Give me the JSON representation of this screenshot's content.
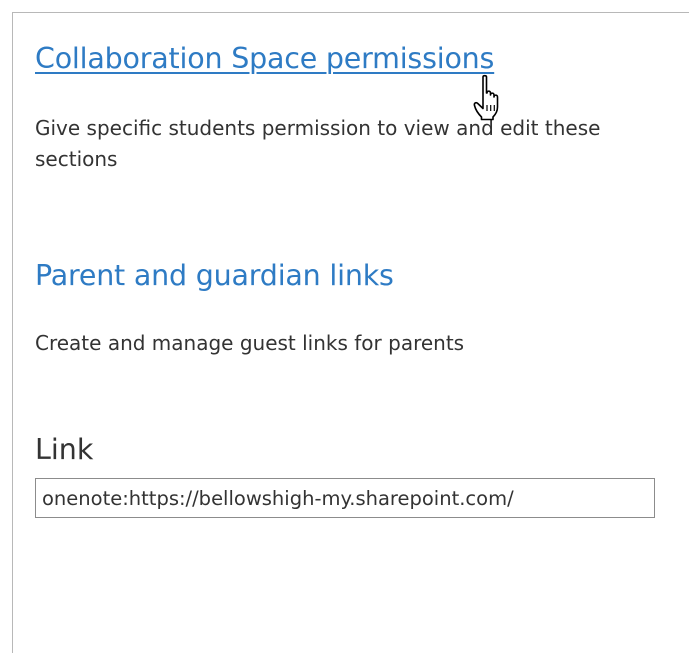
{
  "settings": {
    "collab": {
      "title": "Collaboration Space permissions",
      "description": "Give specific students permission to view and edit these sections"
    },
    "parents": {
      "title": "Parent and guardian links",
      "description": "Create and manage guest links for parents"
    },
    "link": {
      "label": "Link",
      "value": "onenote:https://bellowshigh-my.sharepoint.com/"
    }
  },
  "colors": {
    "link_blue": "#2e7bc4",
    "text": "#333333",
    "border": "#8c8c8c"
  },
  "pointer": {
    "icon": "hand-pointer-icon"
  }
}
